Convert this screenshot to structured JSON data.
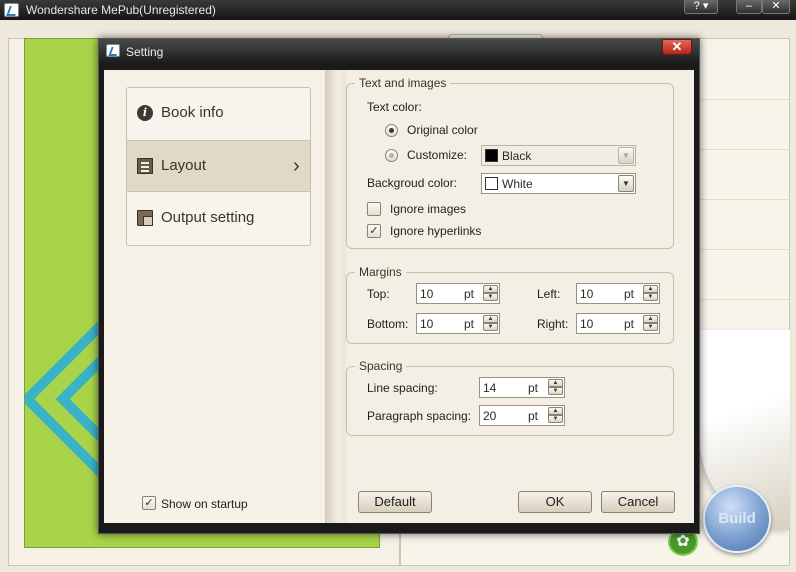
{
  "app": {
    "title": "Wondershare MePub(Unregistered)",
    "help_label": "?",
    "menu_arrow": "▾",
    "minimize_label": "–",
    "close_label": "✕",
    "build_label": "Build"
  },
  "dialog": {
    "title": "Setting",
    "close_label": "✕",
    "nav": [
      {
        "label": "Book info",
        "icon": "info-icon"
      },
      {
        "label": "Layout",
        "icon": "layout-icon",
        "active": true
      },
      {
        "label": "Output setting",
        "icon": "output-icon"
      }
    ],
    "show_on_startup": {
      "label": "Show on startup",
      "checked": true
    },
    "text_images": {
      "title": "Text and images",
      "text_color_label": "Text color:",
      "original_color_label": "Original color",
      "customize_label": "Customize:",
      "customize_value": "Black",
      "customize_swatch": "#000000",
      "background_label": "Backgroud color:",
      "background_value": "White",
      "background_swatch": "#ffffff",
      "ignore_images_label": "Ignore images",
      "ignore_hyperlinks_label": "Ignore hyperlinks"
    },
    "margins": {
      "title": "Margins",
      "top_label": "Top:",
      "top_value": "10",
      "bottom_label": "Bottom:",
      "bottom_value": "10",
      "left_label": "Left:",
      "left_value": "10",
      "right_label": "Right:",
      "right_value": "10",
      "unit": "pt"
    },
    "spacing": {
      "title": "Spacing",
      "line_label": "Line spacing:",
      "line_value": "14",
      "paragraph_label": "Paragraph spacing:",
      "paragraph_value": "20",
      "unit": "pt"
    },
    "buttons": {
      "default": "Default",
      "ok": "OK",
      "cancel": "Cancel"
    }
  },
  "colors": {
    "accent_green": "#a9d449",
    "accent_teal": "#3ab3c6",
    "close_red": "#c8382a",
    "build_blue": "#7a9ecf"
  }
}
